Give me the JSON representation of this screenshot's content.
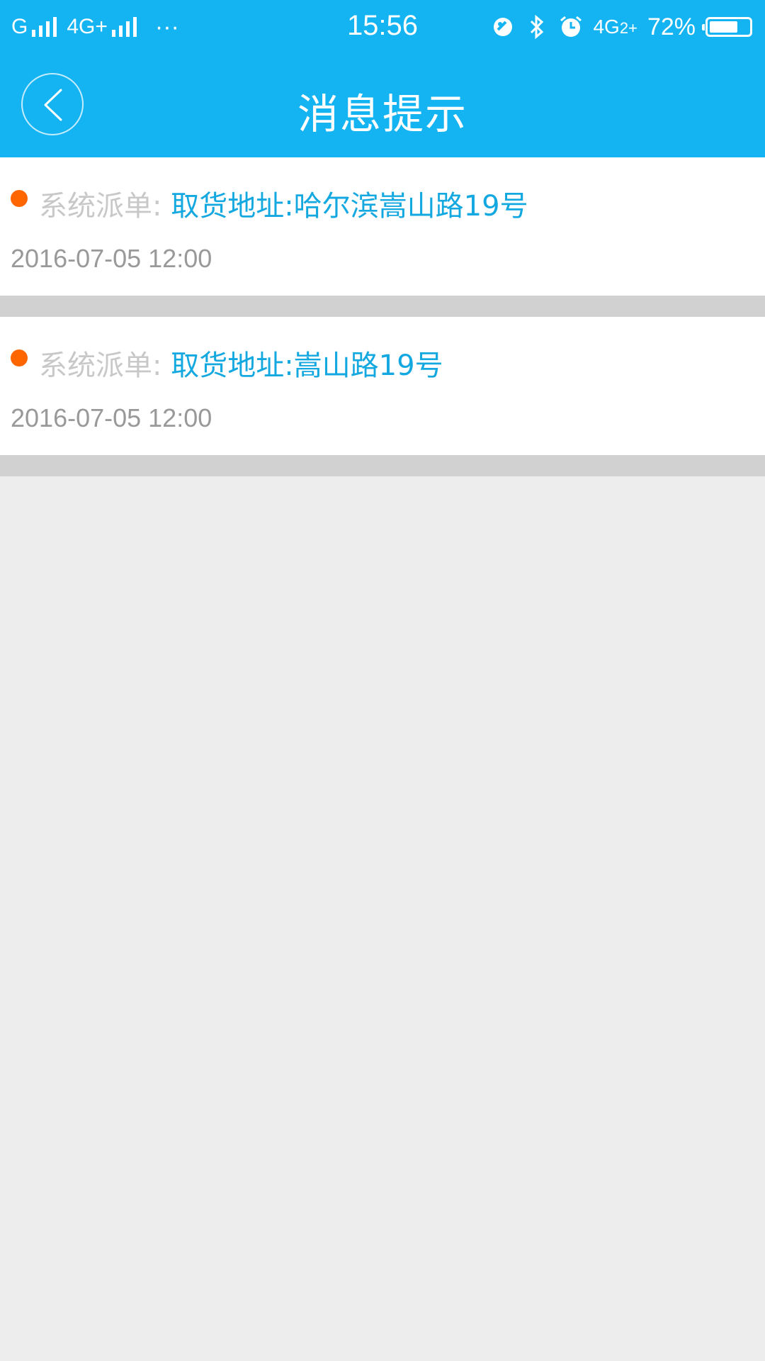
{
  "status_bar": {
    "carrier1": "G",
    "carrier2": "4G+",
    "more": "···",
    "time": "15:56",
    "network_right": "4G",
    "network_right_sup": "2+",
    "battery_text": "72%",
    "battery_level": 0.72
  },
  "header": {
    "title": "消息提示",
    "back_icon": "chevron-left-icon"
  },
  "messages": [
    {
      "label": "系统派单: ",
      "content": "取货地址:哈尔滨嵩山路19号",
      "time": "2016-07-05 12:00"
    },
    {
      "label": "系统派单: ",
      "content": "取货地址:嵩山路19号",
      "time": "2016-07-05 12:00"
    }
  ],
  "colors": {
    "primary": "#14b4f3",
    "accent_dot": "#ff6600",
    "link_text": "#14a8e0",
    "label_text": "#c8c8c8",
    "time_text": "#999999",
    "background": "#ededed",
    "separator": "#d1d1d1"
  }
}
